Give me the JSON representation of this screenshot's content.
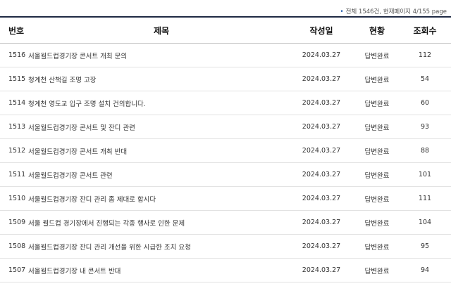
{
  "summary": {
    "bullet": "•",
    "text": "전체 1546건, 현재페이지 4/155 page"
  },
  "table": {
    "headers": {
      "no": "번호",
      "title": "제목",
      "date": "작성일",
      "status": "현황",
      "views": "조회수"
    },
    "rows": [
      {
        "no": "1516",
        "title": "서울월드컵경기장 콘서트 개최 문의",
        "date": "2024.03.27",
        "status": "답변완료",
        "views": "112"
      },
      {
        "no": "1515",
        "title": "청계천 산책길 조명 고장",
        "date": "2024.03.27",
        "status": "답변완료",
        "views": "54"
      },
      {
        "no": "1514",
        "title": "청계천 영도교 입구 조명 설치 건의합니다.",
        "date": "2024.03.27",
        "status": "답변완료",
        "views": "60"
      },
      {
        "no": "1513",
        "title": "서울월드컵경기장 콘서트 및 잔디 관련",
        "date": "2024.03.27",
        "status": "답변완료",
        "views": "93"
      },
      {
        "no": "1512",
        "title": "서울월드컵경기장 콘서트 개최 반대",
        "date": "2024.03.27",
        "status": "답변완료",
        "views": "88"
      },
      {
        "no": "1511",
        "title": "서울월드컵경기장 콘서트 관련",
        "date": "2024.03.27",
        "status": "답변완료",
        "views": "101"
      },
      {
        "no": "1510",
        "title": "서울월드컵경기장 잔디 관리 좀 제대로 합시다",
        "date": "2024.03.27",
        "status": "답변완료",
        "views": "111"
      },
      {
        "no": "1509",
        "title": "서울 월드컵 경기장에서 진행되는 각종 행사로 인한 문제",
        "date": "2024.03.27",
        "status": "답변완료",
        "views": "104"
      },
      {
        "no": "1508",
        "title": "서울월드컵경기장 잔디 관리 개선을 위한 시급한 조치 요청",
        "date": "2024.03.27",
        "status": "답변완료",
        "views": "95"
      },
      {
        "no": "1507",
        "title": "서울월드컵경기장 내 콘서트 반대",
        "date": "2024.03.27",
        "status": "답변완료",
        "views": "94"
      }
    ]
  }
}
